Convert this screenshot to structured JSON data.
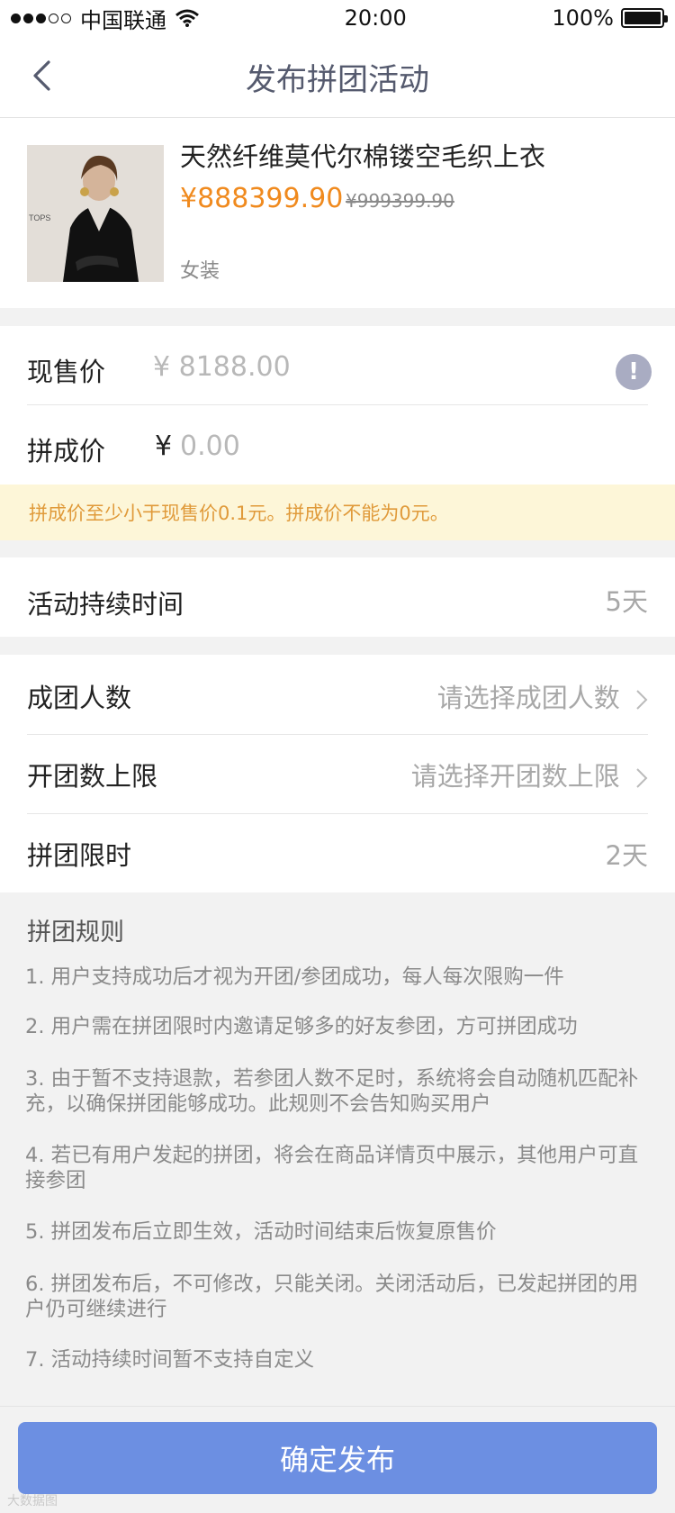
{
  "status_bar": {
    "carrier": "中国联通",
    "time": "20:00",
    "battery": "100%",
    "battery_level": 1.0
  },
  "nav": {
    "title": "发布拼团活动",
    "back_icon": "chevron-left-icon"
  },
  "product": {
    "name": "天然纤维莫代尔棉镂空毛织上衣",
    "price": "¥888399.90",
    "original_price": "¥999399.90",
    "category": "女装",
    "image_label": "TOPS"
  },
  "pricing": {
    "current_label": "现售价",
    "current_value": "¥ 8188.00",
    "group_label": "拼成价",
    "group_currency": "¥",
    "group_placeholder": "0.00",
    "info_icon": "!",
    "warning": "拼成价至少小于现售价0.1元。拼成价不能为0元。"
  },
  "duration": {
    "label": "活动持续时间",
    "value": "5天"
  },
  "options": {
    "group_size_label": "成团人数",
    "group_size_value": "请选择成团人数",
    "group_limit_label": "开团数上限",
    "group_limit_value": "请选择开团数上限",
    "time_limit_label": "拼团限时",
    "time_limit_value": "2天"
  },
  "rules": {
    "title": "拼团规则",
    "items": [
      "1. 用户支持成功后才视为开团/参团成功，每人每次限购一件",
      "2. 用户需在拼团限时内邀请足够多的好友参团，方可拼团成功",
      "3. 由于暂不支持退款，若参团人数不足时，系统将会自动随机匹配补充，以确保拼团能够成功。此规则不会告知购买用户",
      "4. 若已有用户发起的拼团，将会在商品详情页中展示，其他用户可直接参团",
      "5. 拼团发布后立即生效，活动时间结束后恢复原售价",
      "6. 拼团发布后，不可修改，只能关闭。关闭活动后，已发起拼团的用户仍可继续进行",
      "7. 活动持续时间暂不支持自定义"
    ]
  },
  "footer": {
    "submit_label": "确定发布",
    "watermark": "大数据图"
  },
  "colors": {
    "accent_button": "#6c8fe2",
    "price_orange": "#f08a1e",
    "warning_bg": "#fdf6d8",
    "warning_text": "#e09a3a"
  }
}
